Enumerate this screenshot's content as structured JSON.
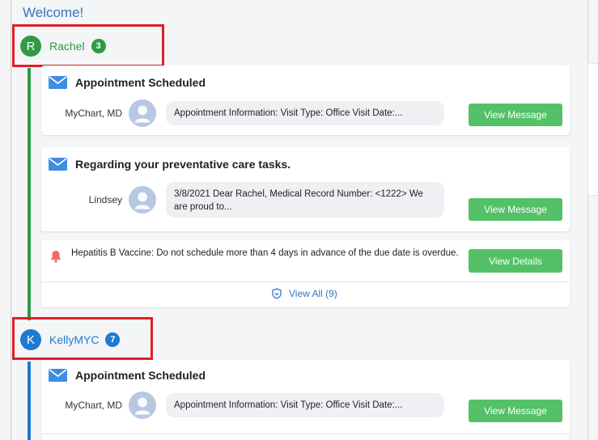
{
  "page": {
    "welcome": "Welcome!"
  },
  "people": [
    {
      "initial": "R",
      "name": "Rachel",
      "count": "3",
      "color": "#2f9a43"
    },
    {
      "initial": "K",
      "name": "KellyMYC",
      "count": "7",
      "color": "#1f7ad1"
    }
  ],
  "rachel": {
    "messages": [
      {
        "title": "Appointment Scheduled",
        "sender": "MyChart, MD",
        "preview": "Appointment Information: Visit Type: Office Visit Date:...",
        "button": "View Message"
      },
      {
        "title": "Regarding your preventative care tasks.",
        "sender": "Lindsey",
        "preview": "3/8/2021 Dear Rachel, Medical Record Number: <1222> We are proud to...",
        "button": "View Message"
      }
    ],
    "reminder": {
      "text": "Hepatitis B Vaccine: Do not schedule more than 4 days in advance of the due date is overdue.",
      "button": "View Details"
    },
    "view_all": "View All (9)"
  },
  "kelly": {
    "messages": [
      {
        "title": "Appointment Scheduled",
        "sender": "MyChart, MD",
        "preview": "Appointment Information: Visit Type: Office Visit Date:...",
        "button": "View Message"
      }
    ]
  },
  "colors": {
    "green_button": "#54c168",
    "mail_blue": "#3f8de2",
    "highlight_red": "#e11f26",
    "link_blue": "#2f78c4"
  },
  "icons": {
    "mail": "mail-icon",
    "bell": "bell-icon",
    "shield": "shield-icon",
    "avatar": "user-avatar-icon"
  }
}
